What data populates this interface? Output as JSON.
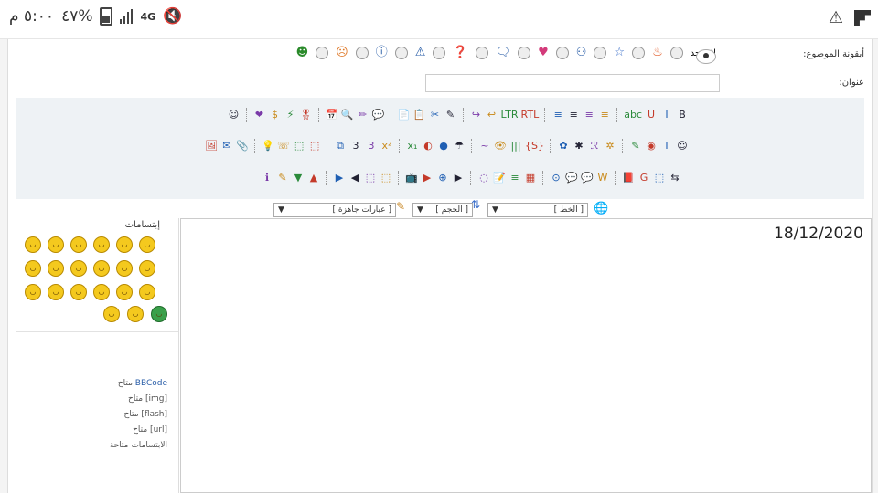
{
  "status_bar": {
    "time": "٥:٠٠ م",
    "battery_percent": "٤٧%",
    "network": "4G",
    "icons": [
      "mute-icon",
      "battery-icon",
      "signal-icon",
      "alert-icon",
      "app-flipboard-icon"
    ]
  },
  "form": {
    "icon_label": "أيقونة الموضوع:",
    "no_icon_label": "لا يوجد",
    "title_label": "عنوان:",
    "title_value": ""
  },
  "toolbar": {
    "row1": [
      "B",
      "I",
      "U",
      "abc",
      "≡",
      "≡",
      "≡",
      "≡",
      "RTL",
      "LTR",
      "↩",
      "↪",
      "✎",
      "✂",
      "📋",
      "📄",
      "💬",
      "✏",
      "🔍",
      "📅",
      "🎖",
      "⚡",
      "$",
      "❤",
      "☺"
    ],
    "row2": [
      "☺",
      "T",
      "◉",
      "✎",
      "✲",
      "ℛ",
      "✱",
      "✿",
      "{S}",
      "|||",
      "👁",
      "~",
      "☂",
      "●",
      "◐",
      "x₁",
      "x²",
      "3",
      "3",
      "⧉",
      "⬚",
      "⬚",
      "☏",
      "💡",
      "📎",
      "✉",
      "🖼"
    ],
    "row3": [
      "⇆",
      "⬚",
      "G",
      "📕",
      "W",
      "💬",
      "💬",
      "⊙",
      "▦",
      "≡",
      "📝",
      "◌",
      "▶",
      "⊕",
      "▶",
      "📺",
      "⬚",
      "⬚",
      "◀",
      "▶",
      "▲",
      "▼",
      "✎",
      "ℹ"
    ]
  },
  "selects": {
    "font": "[ الخط ]",
    "size": "[ الحجم ]",
    "phrases": "[ عبارات جاهزة ]"
  },
  "sidebar": {
    "smilies_title": "إبتسامات",
    "perms": [
      {
        "link": "BBCode",
        "text": " متاح"
      },
      {
        "link": "",
        "text": "[img] متاح"
      },
      {
        "link": "",
        "text": "[flash] متاح"
      },
      {
        "link": "",
        "text": "[url] متاح"
      },
      {
        "link": "",
        "text": "الابتسامات متاحة"
      }
    ]
  },
  "editor": {
    "content": "18/12/2020"
  }
}
